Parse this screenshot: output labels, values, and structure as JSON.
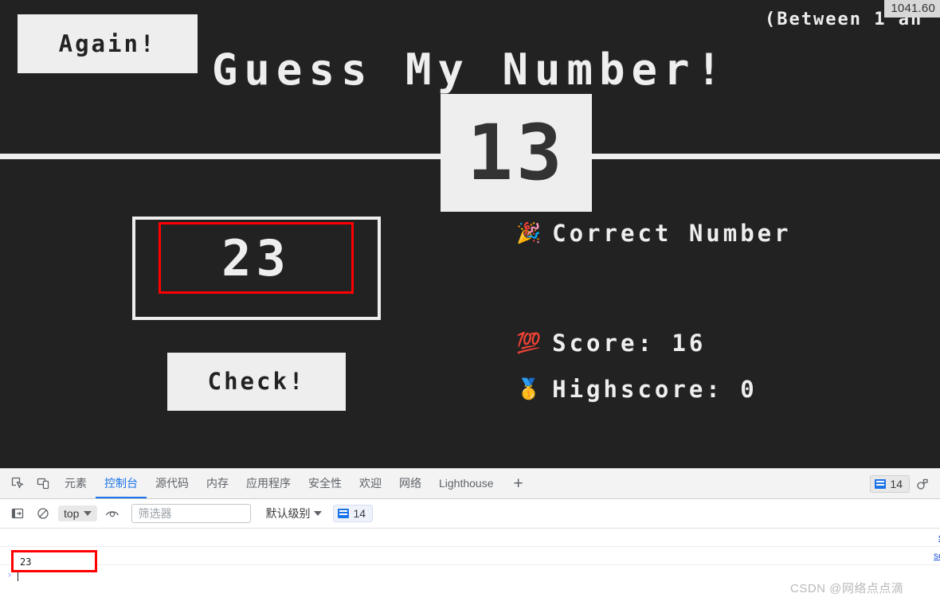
{
  "game": {
    "again_button": "Again!",
    "title": "Guess My Number!",
    "between_label": "(Between 1 an",
    "secret_number": "13",
    "guess_value": "23",
    "check_button": "Check!",
    "message_emoji": "🎉",
    "message": "Correct Number",
    "score_emoji": "💯",
    "score_label": "Score: 16",
    "highscore_emoji": "🥇",
    "highscore_label": "Highscore: 0",
    "size_tooltip": "1041.60",
    "colors": {
      "background": "#222222",
      "foreground": "#eeeeee",
      "highlight_outline": "#ff0000"
    }
  },
  "devtools": {
    "tabs": [
      {
        "label": "元素",
        "active": false
      },
      {
        "label": "控制台",
        "active": true
      },
      {
        "label": "源代码",
        "active": false
      },
      {
        "label": "内存",
        "active": false
      },
      {
        "label": "应用程序",
        "active": false
      },
      {
        "label": "安全性",
        "active": false
      },
      {
        "label": "欢迎",
        "active": false
      },
      {
        "label": "网络",
        "active": false
      },
      {
        "label": "Lighthouse",
        "active": false
      }
    ],
    "add_tab": "+",
    "message_count": "14",
    "console": {
      "context": "top",
      "filter_placeholder": "筛选器",
      "filter_value": "",
      "level": "默认级别",
      "level_count": "14",
      "rows": [
        {
          "text": "",
          "source": "s"
        },
        {
          "text": "23",
          "source": "sc"
        }
      ],
      "prompt_arrow": "›"
    }
  },
  "watermark": "CSDN @网络点点滴"
}
